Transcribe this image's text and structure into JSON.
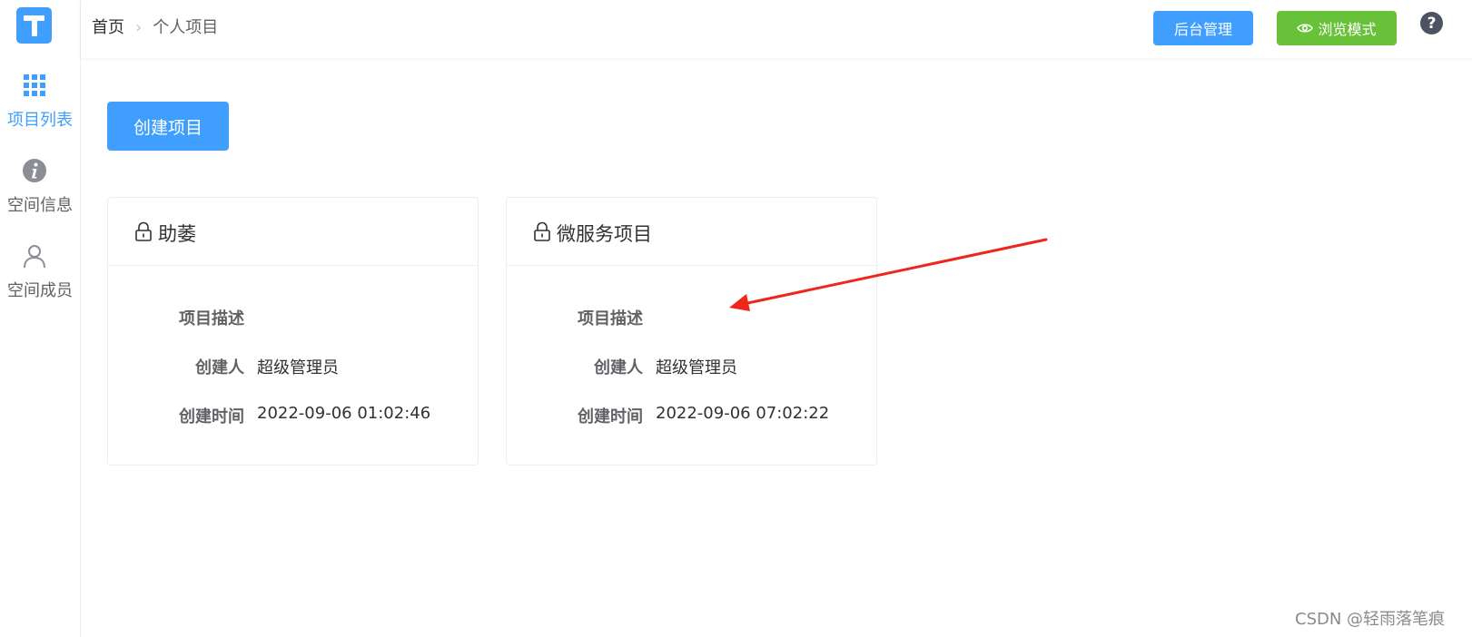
{
  "sidebar": {
    "items": [
      {
        "label": "项目列表",
        "icon": "grid-icon",
        "active": true
      },
      {
        "label": "空间信息",
        "icon": "info-icon",
        "active": false
      },
      {
        "label": "空间成员",
        "icon": "user-icon",
        "active": false
      }
    ]
  },
  "header": {
    "breadcrumb": {
      "home": "首页",
      "current": "个人项目"
    },
    "admin_button": "后台管理",
    "browse_button": "浏览模式",
    "help_glyph": "?"
  },
  "main": {
    "create_button": "创建项目",
    "projects": [
      {
        "title": "助萎",
        "desc_label": "项目描述",
        "desc_value": "",
        "creator_label": "创建人",
        "creator": "超级管理员",
        "time_label": "创建时间",
        "created_at": "2022-09-06 01:02:46"
      },
      {
        "title": "微服务项目",
        "desc_label": "项目描述",
        "desc_value": "",
        "creator_label": "创建人",
        "creator": "超级管理员",
        "time_label": "创建时间",
        "created_at": "2022-09-06 07:02:22"
      }
    ]
  },
  "watermark": "CSDN @轻雨落笔痕",
  "colors": {
    "primary": "#409eff",
    "success": "#67c23a",
    "annotation": "#f0251c"
  }
}
